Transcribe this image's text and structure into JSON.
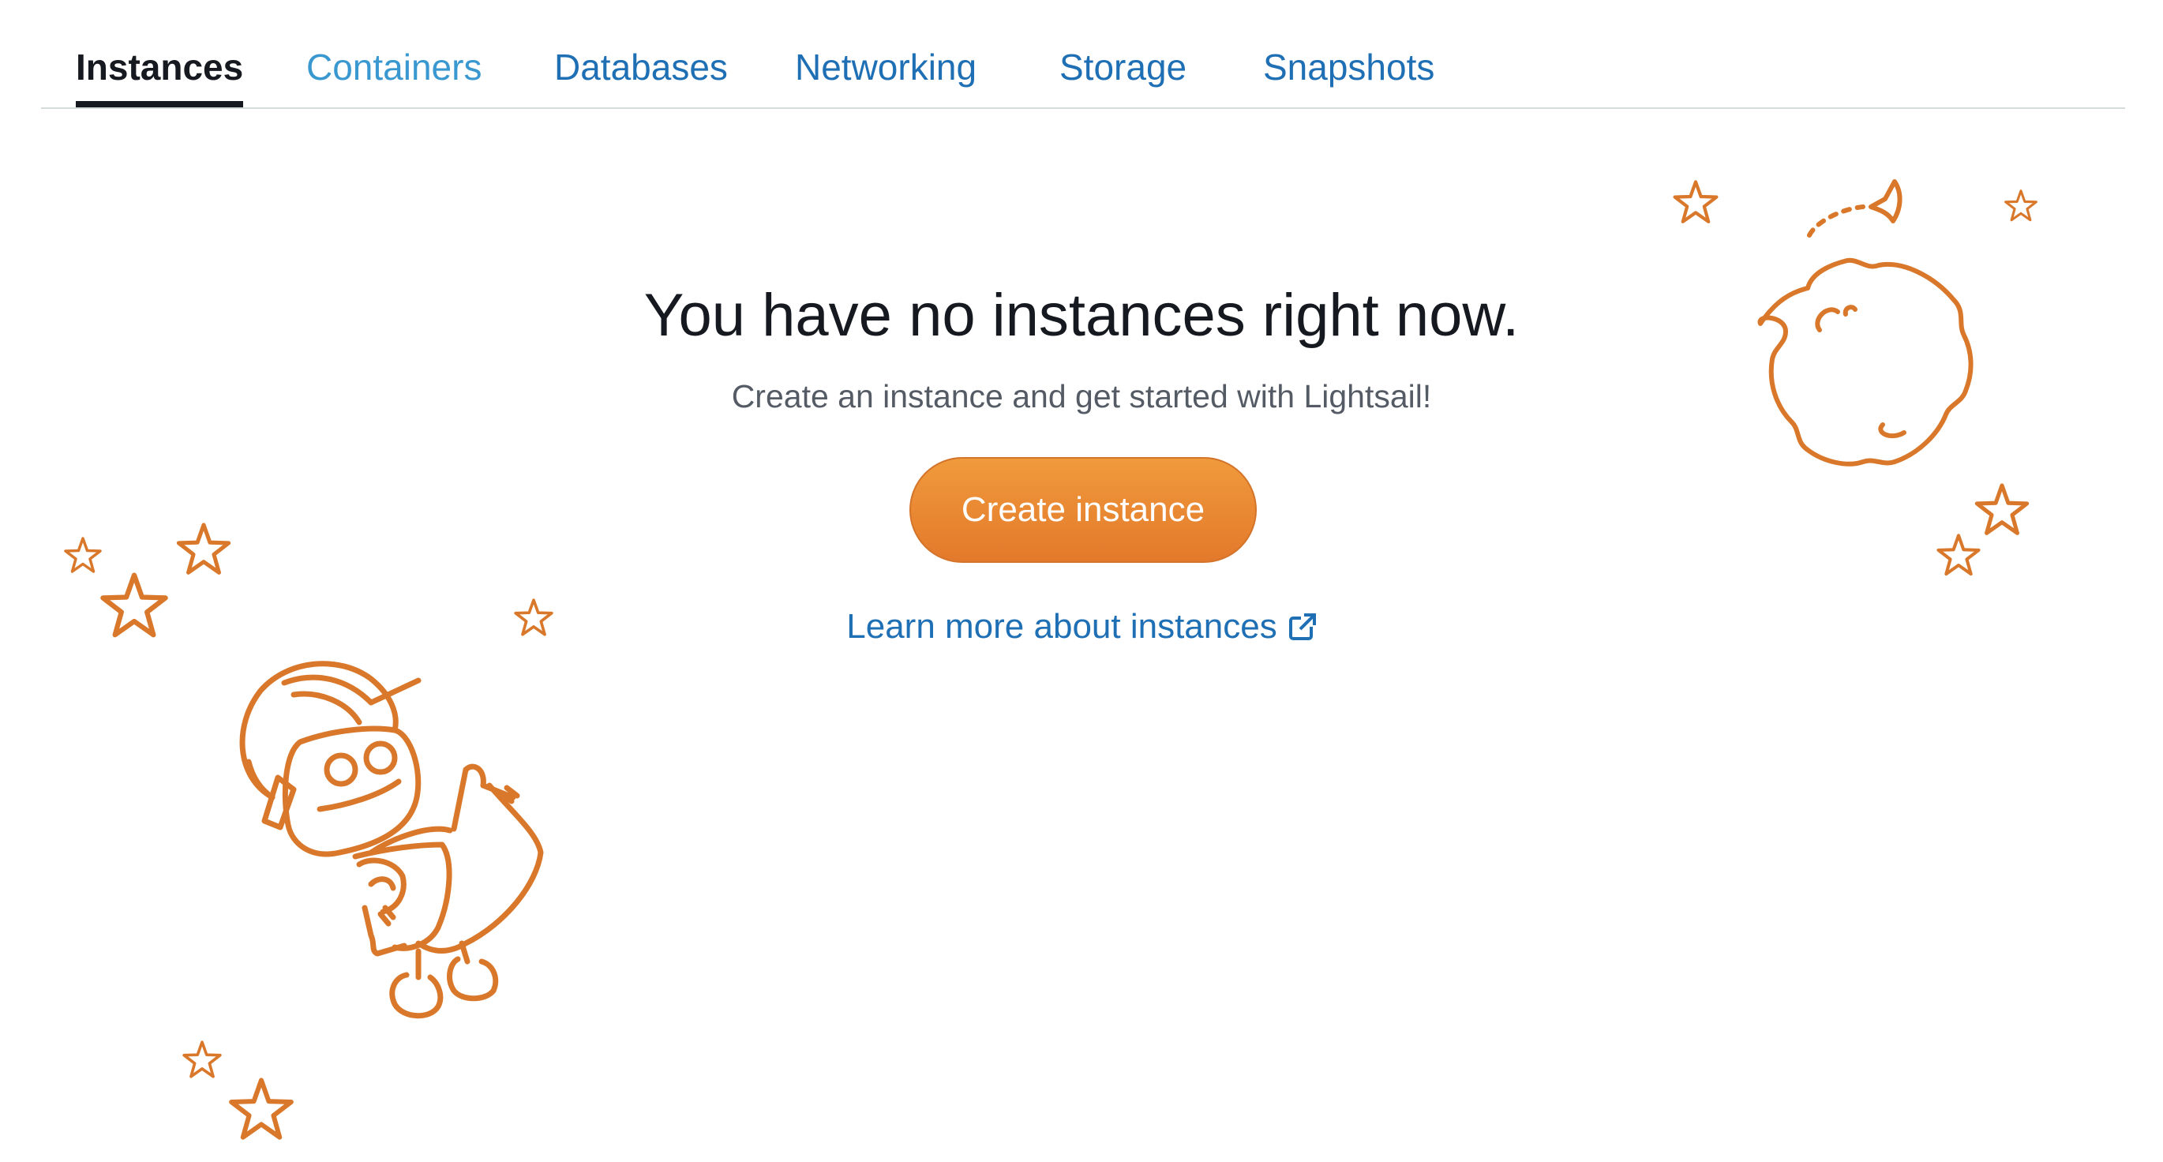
{
  "tabs": [
    {
      "label": "Instances",
      "active": true
    },
    {
      "label": "Containers",
      "active": false
    },
    {
      "label": "Databases",
      "active": false
    },
    {
      "label": "Networking",
      "active": false
    },
    {
      "label": "Storage",
      "active": false
    },
    {
      "label": "Snapshots",
      "active": false
    }
  ],
  "empty_state": {
    "headline": "You have no instances right now.",
    "subline": "Create an instance and get started with Lightsail!",
    "create_button": "Create instance",
    "learn_more": "Learn more about instances",
    "learn_more_icon": "external-link-icon"
  },
  "colors": {
    "accent_orange": "#e8832f",
    "link_blue": "#1f6fb5",
    "active_tab": "#16191f",
    "illustration_stroke": "#d9782b"
  },
  "illustrations": {
    "robot": "robot-astronaut-illustration",
    "moon": "moon-planet-illustration",
    "stars": "star-icon"
  }
}
